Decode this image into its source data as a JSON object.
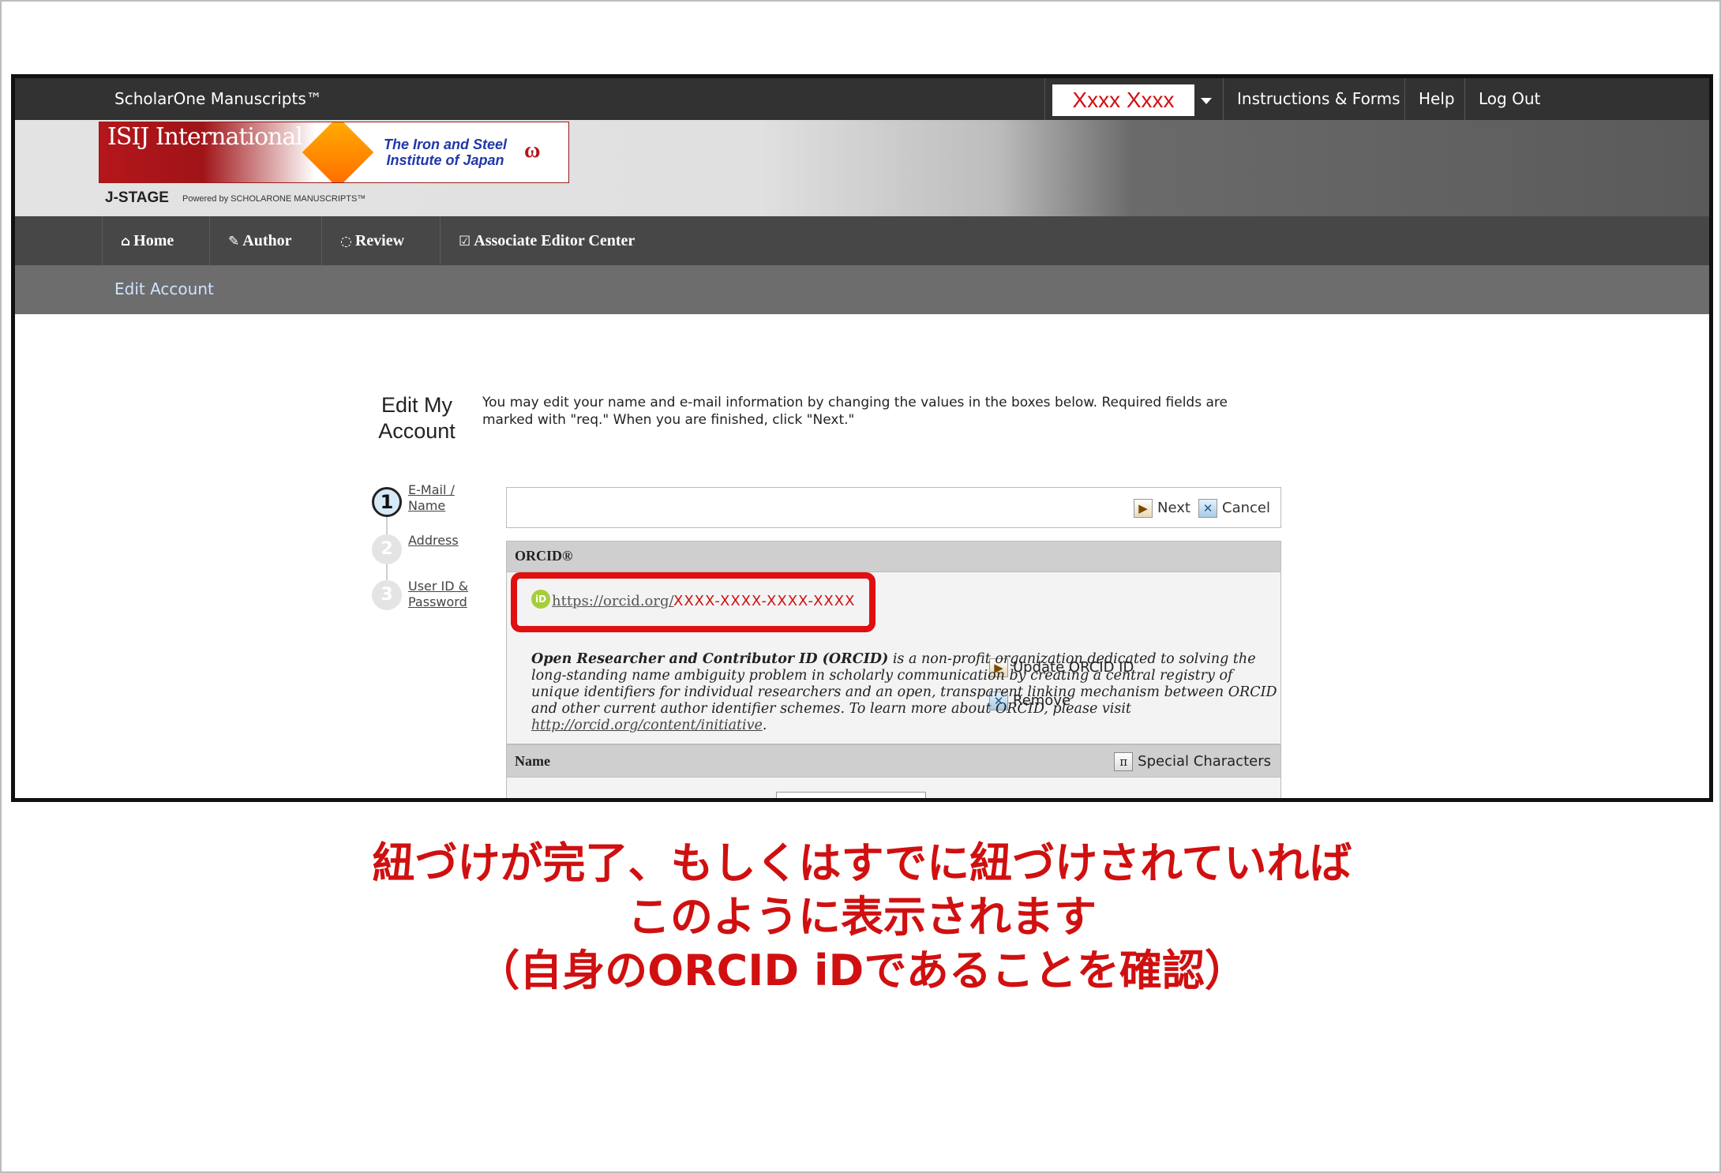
{
  "topbar": {
    "app_name": "ScholarOne Manuscripts™",
    "user_name": "Xxxx Xxxx",
    "links": [
      "Instructions & Forms",
      "Help",
      "Log Out"
    ]
  },
  "banner": {
    "logo_name": "ISIJ International",
    "logo_org": "The Iron and Steel Institute of Japan",
    "jstage": "J-STAGE",
    "powered": "Powered by SCHOLARONE MANUSCRIPTS™"
  },
  "nav": {
    "home": "Home",
    "author": "Author",
    "review": "Review",
    "associate_editor": "Associate Editor Center"
  },
  "subnav": {
    "edit_account": "Edit Account"
  },
  "page": {
    "title": "Edit My Account",
    "intro": "You may edit your name and e-mail information by changing the values in the boxes below. Required fields are marked with \"req.\" When you are finished, click \"Next.\""
  },
  "steps": [
    {
      "num": "1",
      "label": "E-Mail / Name"
    },
    {
      "num": "2",
      "label": "Address"
    },
    {
      "num": "3",
      "label": "User ID & Password"
    }
  ],
  "actions": {
    "next": "Next",
    "cancel": "Cancel"
  },
  "orcid": {
    "header": "ORCID®",
    "icon_text": "iD",
    "url_prefix": "https://orcid.org/",
    "id_value": "XXXX-XXXX-XXXX-XXXX",
    "update": "Update ORCID ID",
    "remove": "Remove",
    "desc_bold": "Open Researcher and Contributor ID (ORCID)",
    "desc_text": " is a non-profit organization dedicated to solving the long-standing name ambiguity problem in scholarly communication by creating a central registry of unique identifiers for individual researchers and an open, transparent linking mechanism between ORCID and other current author identifier schemes. To learn more about ORCID, please visit ",
    "desc_link": "http://orcid.org/content/initiative",
    "desc_end": "."
  },
  "name_section": {
    "header": "Name",
    "special_chars": "Special Characters"
  },
  "caption": {
    "line1": "紐づけが完了、もしくはすでに紐づけされていれば",
    "line2": "このように表示されます",
    "line3": "（自身のORCID iDであることを確認）"
  },
  "colors": {
    "highlight": "#e01010",
    "caption": "#d01010",
    "topbar": "#323232"
  }
}
